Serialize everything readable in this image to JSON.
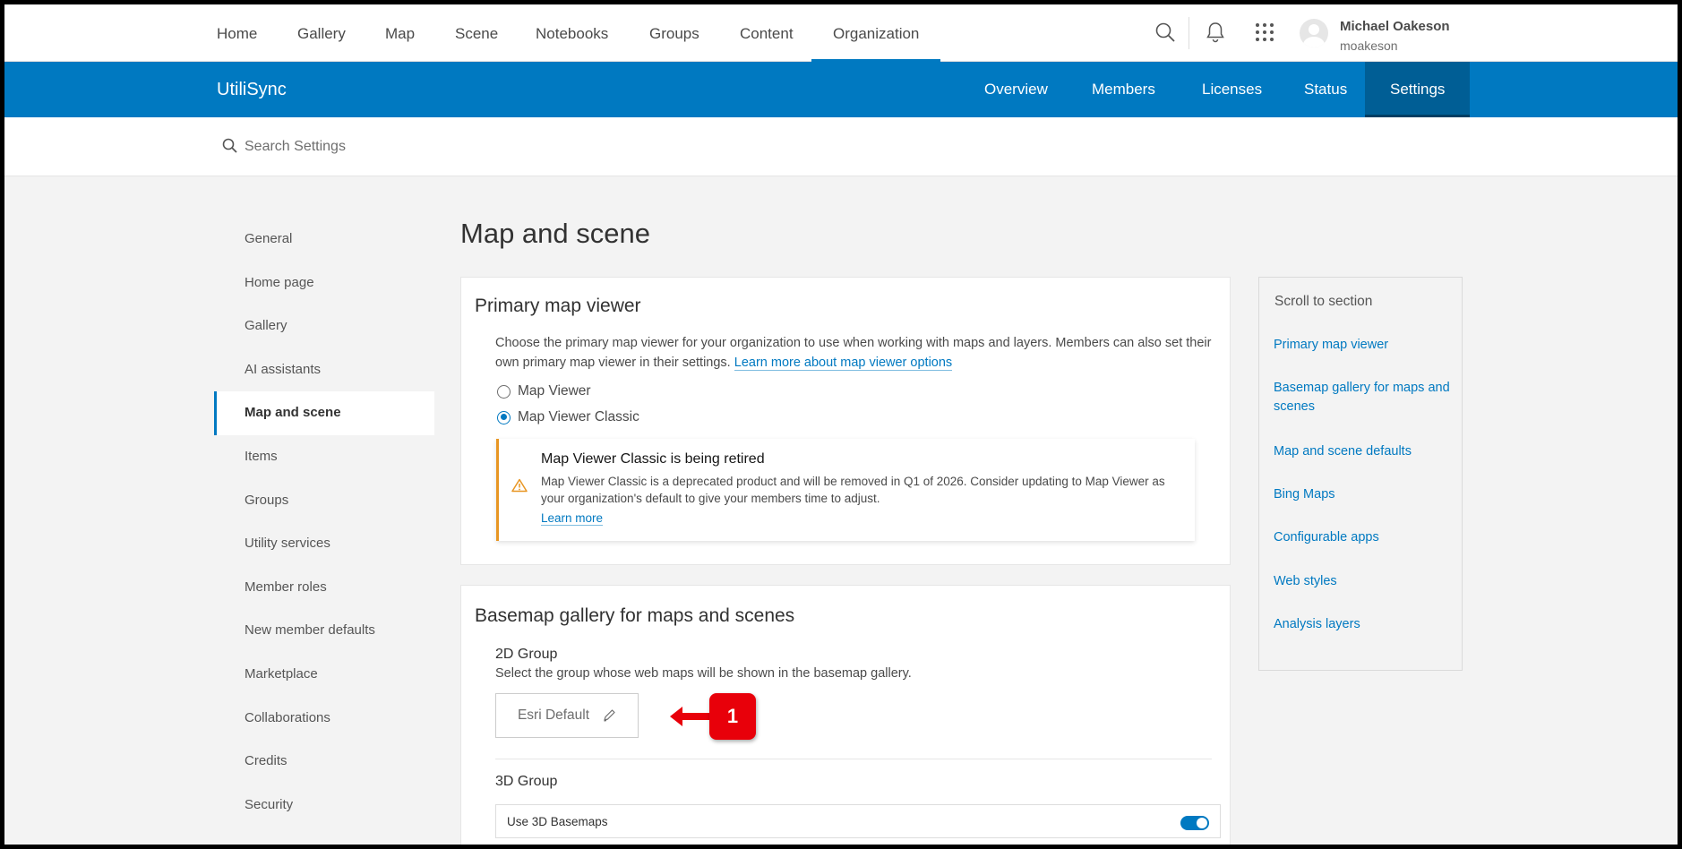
{
  "topnav": {
    "items": [
      "Home",
      "Gallery",
      "Map",
      "Scene",
      "Notebooks",
      "Groups",
      "Content",
      "Organization"
    ],
    "active": "Organization",
    "user": {
      "name": "Michael Oakeson",
      "username": "moakeson"
    },
    "icons": [
      "search-icon",
      "bell-icon",
      "apps-grid-icon",
      "avatar"
    ]
  },
  "orgbar": {
    "org_name": "UtiliSync",
    "tabs": [
      "Overview",
      "Members",
      "Licenses",
      "Status",
      "Settings"
    ],
    "active": "Settings"
  },
  "search": {
    "placeholder": "Search Settings"
  },
  "sidebar": {
    "items": [
      "General",
      "Home page",
      "Gallery",
      "AI assistants",
      "Map and scene",
      "Items",
      "Groups",
      "Utility services",
      "Member roles",
      "New member defaults",
      "Marketplace",
      "Collaborations",
      "Credits",
      "Security"
    ],
    "active": "Map and scene"
  },
  "page_title": "Map and scene",
  "primary_viewer": {
    "title": "Primary map viewer",
    "description": "Choose the primary map viewer for your organization to use when working with maps and layers. Members can also set their own primary map viewer in their settings.",
    "description_link": "Learn more about map viewer options",
    "options": [
      "Map Viewer",
      "Map Viewer Classic"
    ],
    "selected": "Map Viewer Classic",
    "notice": {
      "title": "Map Viewer Classic is being retired",
      "body": "Map Viewer Classic is a deprecated product and will be removed in Q1 of 2026. Consider updating to Map Viewer as your organization's default to give your members time to adjust.",
      "link": "Learn more",
      "accent": "#e89623"
    }
  },
  "basemap": {
    "title": "Basemap gallery for maps and scenes",
    "group2d": {
      "label": "2D Group",
      "description": "Select the group whose web maps will be shown in the basemap gallery.",
      "button": "Esri Default"
    },
    "group3d": {
      "label": "3D Group",
      "toggle_label": "Use 3D Basemaps",
      "toggle_on": true
    }
  },
  "callout": {
    "number": "1",
    "color": "#e8000a"
  },
  "scroll_to": {
    "title": "Scroll to section",
    "links": [
      "Primary map viewer",
      "Basemap gallery for maps and scenes",
      "Map and scene defaults",
      "Bing Maps",
      "Configurable apps",
      "Web styles",
      "Analysis layers"
    ]
  },
  "colors": {
    "brand": "#0079c1",
    "brand_dark": "#005e95",
    "background": "#f3f3f3"
  }
}
